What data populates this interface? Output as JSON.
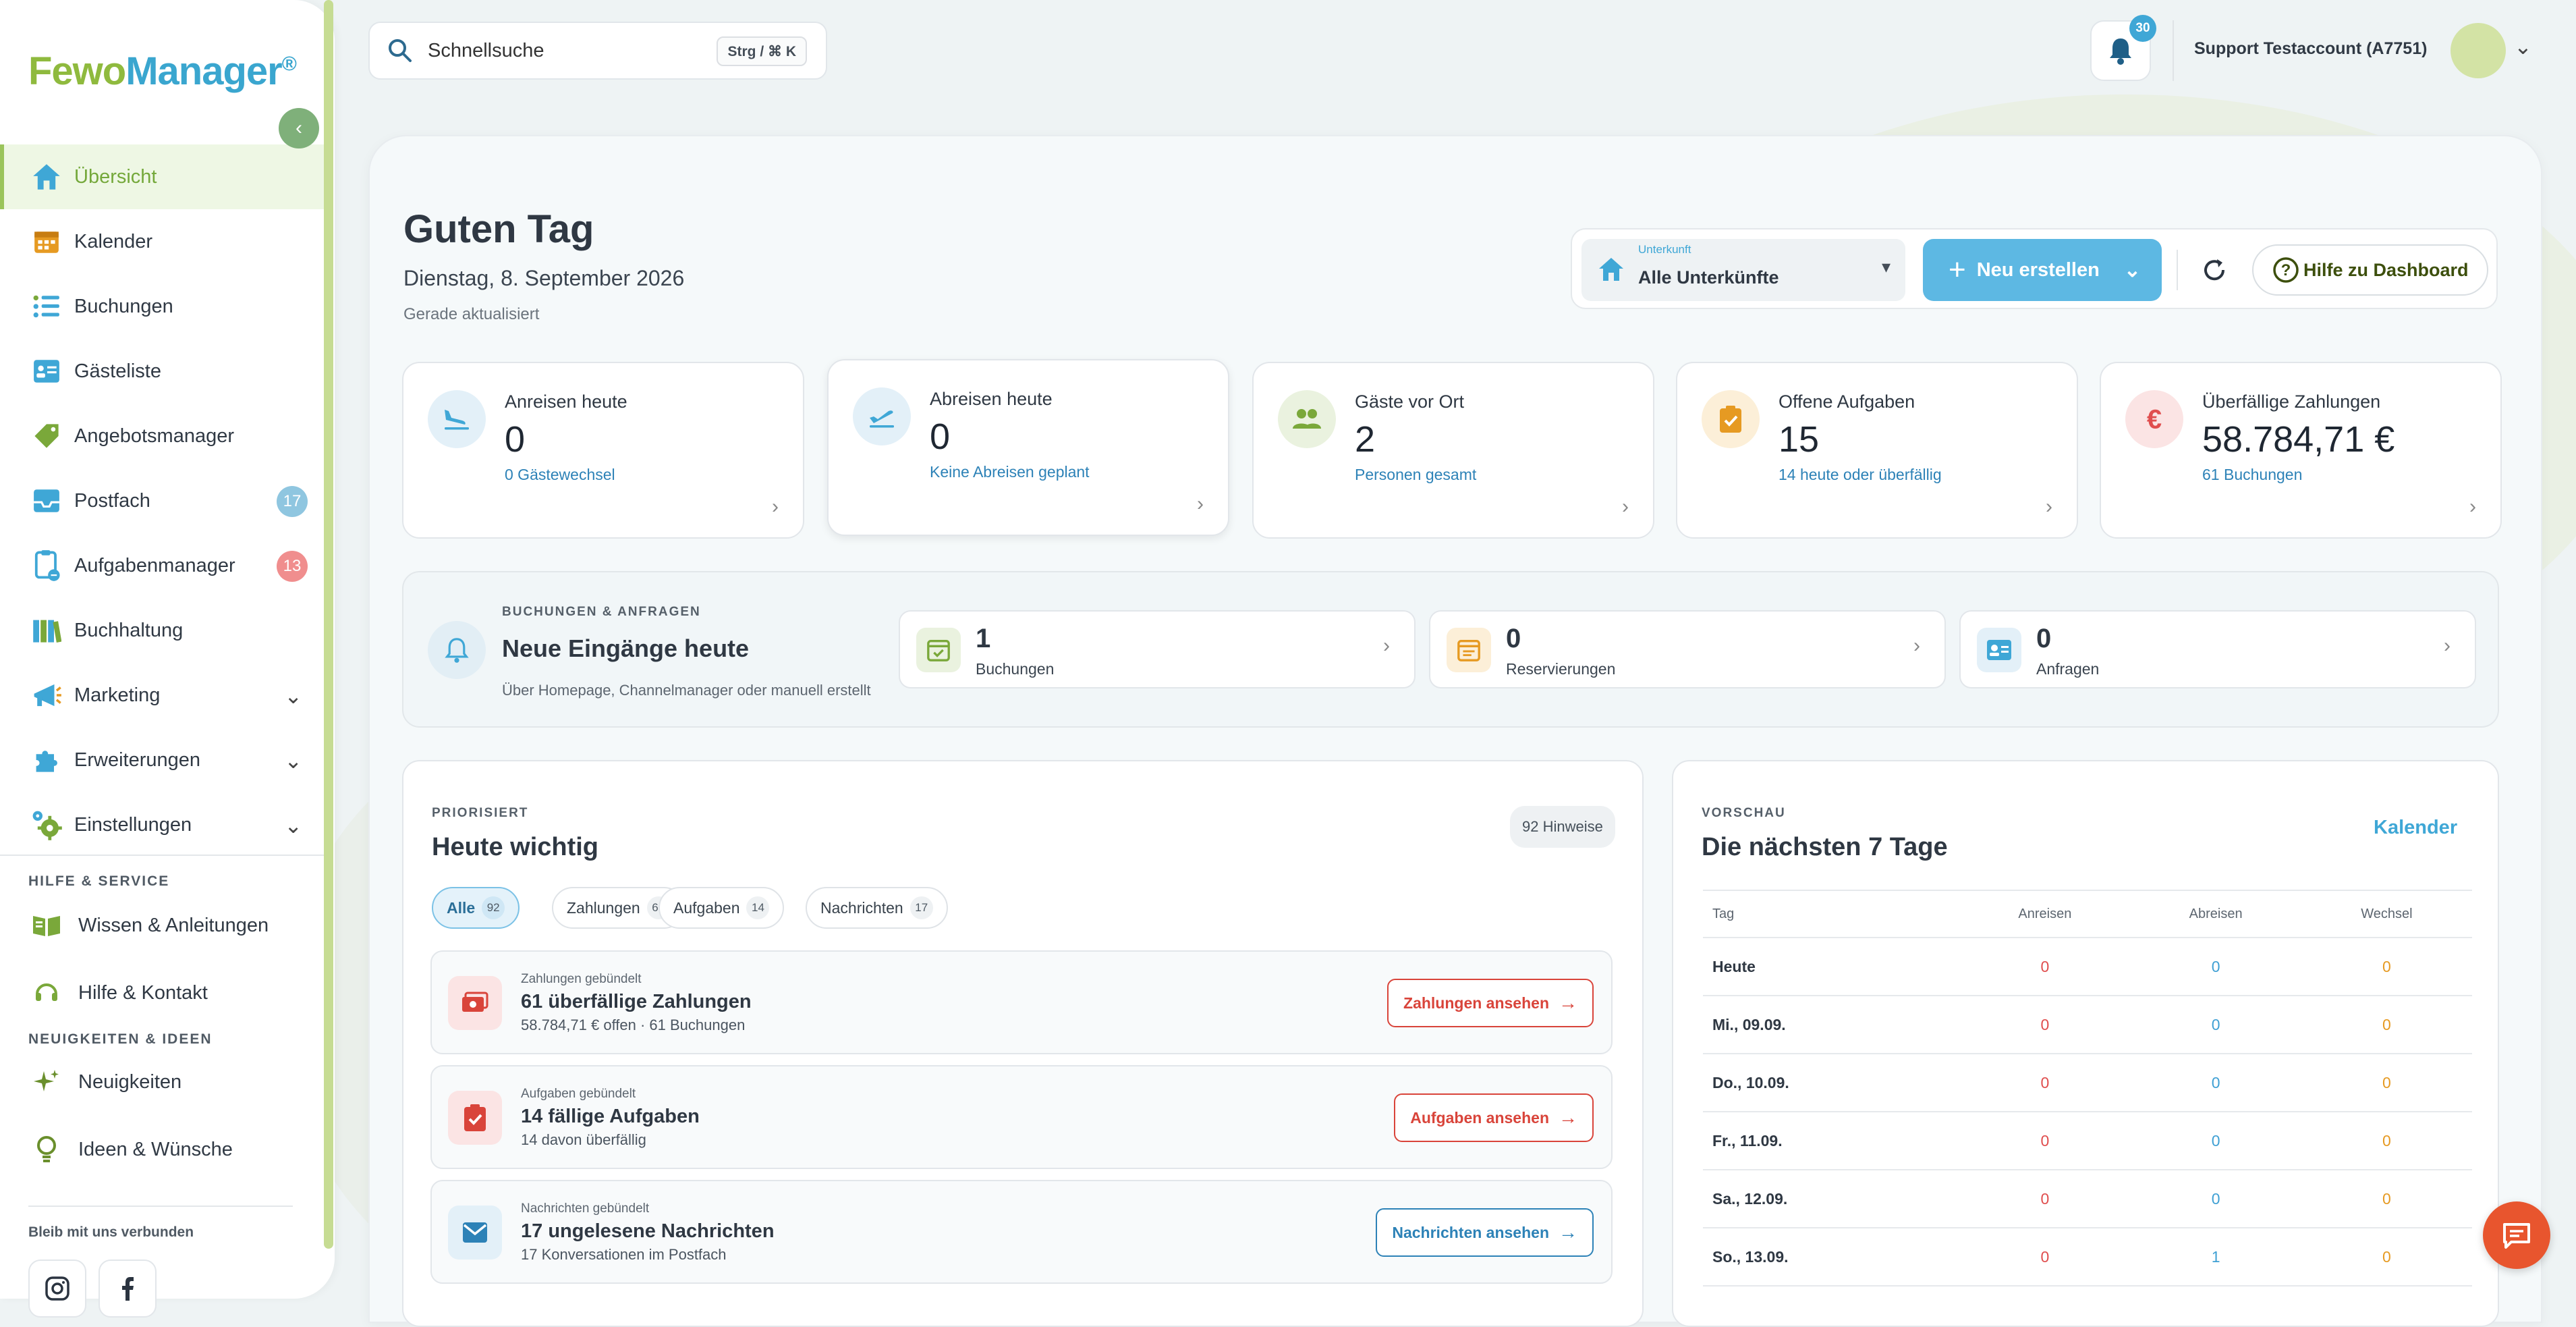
{
  "app": {
    "logo_main": "Fewo",
    "logo_accent": "Manager",
    "logo_mark": "®"
  },
  "sidebar": {
    "items": [
      {
        "label": "Übersicht",
        "icon": "home-icon",
        "active": true
      },
      {
        "label": "Kalender",
        "icon": "calendar-icon"
      },
      {
        "label": "Buchungen",
        "icon": "list-icon"
      },
      {
        "label": "Gästeliste",
        "icon": "guest-list-icon"
      },
      {
        "label": "Angebotsmanager",
        "icon": "tag-icon"
      },
      {
        "label": "Postfach",
        "icon": "inbox-icon",
        "badge": "17",
        "badge_color": "#8fc6e0"
      },
      {
        "label": "Aufgabenmanager",
        "icon": "clipboard-icon",
        "badge": "13",
        "badge_color": "#f08e8e"
      },
      {
        "label": "Buchhaltung",
        "icon": "books-icon"
      },
      {
        "label": "Marketing",
        "icon": "megaphone-icon",
        "expandable": true
      },
      {
        "label": "Erweiterungen",
        "icon": "puzzle-icon",
        "expandable": true
      },
      {
        "label": "Einstellungen",
        "icon": "gear-icon",
        "expandable": true
      }
    ],
    "help_heading": "HILFE & SERVICE",
    "help_links": [
      {
        "label": "Wissen & Anleitungen",
        "icon": "book-icon"
      },
      {
        "label": "Hilfe & Kontakt",
        "icon": "headset-icon"
      }
    ],
    "news_heading": "NEUIGKEITEN & IDEEN",
    "news_links": [
      {
        "label": "Neuigkeiten",
        "icon": "sparkle-icon"
      },
      {
        "label": "Ideen & Wünsche",
        "icon": "lightbulb-icon"
      }
    ],
    "connect_label": "Bleib mit uns verbunden"
  },
  "topbar": {
    "search_placeholder": "Schnellsuche",
    "search_shortcut": "Strg / ⌘ K",
    "notifications": "30",
    "account": "Support Testaccount (A7751)"
  },
  "header": {
    "greeting": "Guten Tag",
    "date": "Dienstag, 8. September 2026",
    "updated": "Gerade aktualisiert"
  },
  "toolbar": {
    "property_label": "Unterkunft",
    "property_value": "Alle Unterkünfte",
    "new_label": "Neu erstellen",
    "help_label": "Hilfe zu Dashboard"
  },
  "stats": [
    {
      "label": "Anreisen heute",
      "value": "0",
      "sub": "0 Gästewechsel",
      "icon": "plane-arrival-icon",
      "color": "#3fa7d6",
      "bg": "#e3f0f8"
    },
    {
      "label": "Abreisen heute",
      "value": "0",
      "sub": "Keine Abreisen geplant",
      "icon": "plane-departure-icon",
      "color": "#3fa7d6",
      "bg": "#e3f0f8"
    },
    {
      "label": "Gäste vor Ort",
      "value": "2",
      "sub": "Personen gesamt",
      "icon": "people-icon",
      "color": "#7aa83a",
      "bg": "#eaf2df"
    },
    {
      "label": "Offene Aufgaben",
      "value": "15",
      "sub": "14 heute oder überfällig",
      "icon": "task-icon",
      "color": "#e69a22",
      "bg": "#fcefd8"
    },
    {
      "label": "Überfällige Zahlungen",
      "value": "58.784,71 €",
      "sub": "61 Buchungen",
      "icon": "euro-icon",
      "color": "#e04e4e",
      "bg": "#fbe4e4"
    }
  ],
  "incoming": {
    "kicker": "BUCHUNGEN & ANFRAGEN",
    "title": "Neue Eingänge heute",
    "sub": "Über Homepage, Channelmanager oder manuell erstellt",
    "cards": [
      {
        "value": "1",
        "label": "Buchungen",
        "icon": "calendar-check-icon",
        "color": "#7aa83a",
        "bg": "#eaf2df"
      },
      {
        "value": "0",
        "label": "Reservierungen",
        "icon": "calendar-note-icon",
        "color": "#e69a22",
        "bg": "#fcefd8"
      },
      {
        "value": "0",
        "label": "Anfragen",
        "icon": "contact-card-icon",
        "color": "#3fa7d6",
        "bg": "#e3f0f8"
      }
    ]
  },
  "priority": {
    "kicker": "PRIORISIERT",
    "title": "Heute wichtig",
    "hints": "92 Hinweise",
    "filters": [
      {
        "label": "Alle",
        "count": "92",
        "active": true
      },
      {
        "label": "Zahlungen",
        "count": "61"
      },
      {
        "label": "Aufgaben",
        "count": "14"
      },
      {
        "label": "Nachrichten",
        "count": "17"
      }
    ],
    "groups": [
      {
        "kicker": "Zahlungen gebündelt",
        "title": "61 überfällige Zahlungen",
        "sub": "58.784,71 € offen · 61 Buchungen",
        "button": "Zahlungen ansehen",
        "icon": "money-icon",
        "color": "#d9443a",
        "bg": "#fbe4e4"
      },
      {
        "kicker": "Aufgaben gebündelt",
        "title": "14 fällige Aufgaben",
        "sub": "14 davon überfällig",
        "button": "Aufgaben ansehen",
        "icon": "task-icon",
        "color": "#d9443a",
        "bg": "#fbe4e4"
      },
      {
        "kicker": "Nachrichten gebündelt",
        "title": "17 ungelesene Nachrichten",
        "sub": "17 Konversationen im Postfach",
        "button": "Nachrichten ansehen",
        "icon": "mail-icon",
        "color": "#2d82b7",
        "bg": "#e3f0f8"
      }
    ]
  },
  "preview": {
    "kicker": "VORSCHAU",
    "title": "Die nächsten 7 Tage",
    "link": "Kalender",
    "columns": [
      "Tag",
      "Anreisen",
      "Abreisen",
      "Wechsel"
    ],
    "rows": [
      {
        "day": "Heute",
        "anreisen": "0",
        "abreisen": "0",
        "wechsel": "0"
      },
      {
        "day": "Mi., 09.09.",
        "anreisen": "0",
        "abreisen": "0",
        "wechsel": "0"
      },
      {
        "day": "Do., 10.09.",
        "anreisen": "0",
        "abreisen": "0",
        "wechsel": "0"
      },
      {
        "day": "Fr., 11.09.",
        "anreisen": "0",
        "abreisen": "0",
        "wechsel": "0"
      },
      {
        "day": "Sa., 12.09.",
        "anreisen": "0",
        "abreisen": "0",
        "wechsel": "0"
      },
      {
        "day": "So., 13.09.",
        "anreisen": "0",
        "abreisen": "1",
        "wechsel": "0"
      }
    ]
  }
}
